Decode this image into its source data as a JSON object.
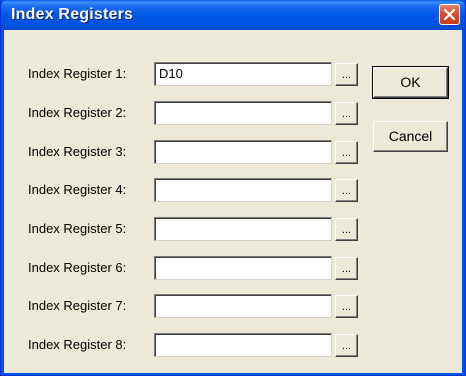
{
  "window": {
    "title": "Index Registers"
  },
  "registers": [
    {
      "label": "Index Register 1:",
      "value": "D10",
      "browse_label": "..."
    },
    {
      "label": "Index Register 2:",
      "value": "",
      "browse_label": "..."
    },
    {
      "label": "Index Register 3:",
      "value": "",
      "browse_label": "..."
    },
    {
      "label": "Index Register 4:",
      "value": "",
      "browse_label": "..."
    },
    {
      "label": "Index Register 5:",
      "value": "",
      "browse_label": "..."
    },
    {
      "label": "Index Register 6:",
      "value": "",
      "browse_label": "..."
    },
    {
      "label": "Index Register 7:",
      "value": "",
      "browse_label": "..."
    },
    {
      "label": "Index Register 8:",
      "value": "",
      "browse_label": "..."
    }
  ],
  "buttons": {
    "ok_label": "OK",
    "cancel_label": "Cancel"
  },
  "icons": {
    "close": "close-icon"
  },
  "colors": {
    "titlebar": "#0058e6",
    "close_button": "#d8502e",
    "dialog_background": "#ece9d8"
  }
}
